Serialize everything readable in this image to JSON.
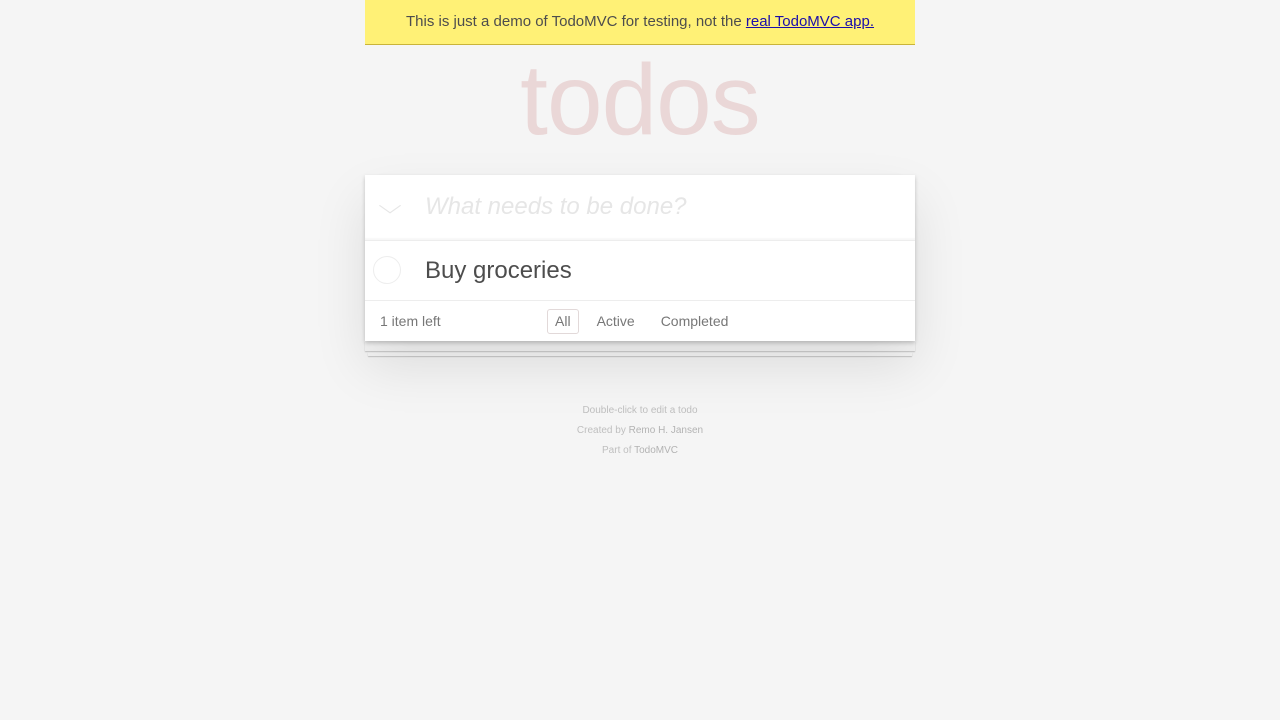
{
  "banner": {
    "text": "This is just a demo of TodoMVC for testing, not the ",
    "link": "real TodoMVC app."
  },
  "header": {
    "title": "todos"
  },
  "new_todo": {
    "placeholder": "What needs to be done?",
    "value": ""
  },
  "toggle_all_icon": "chevron-down-icon",
  "todos": [
    {
      "label": "Buy groceries",
      "completed": false
    }
  ],
  "footer": {
    "count_text": "1 item left",
    "filters": [
      {
        "label": "All",
        "selected": true
      },
      {
        "label": "Active",
        "selected": false
      },
      {
        "label": "Completed",
        "selected": false
      }
    ]
  },
  "info": {
    "line1": "Double-click to edit a todo",
    "created_prefix": "Created by ",
    "author": "Remo H. Jansen",
    "part_prefix": "Part of ",
    "part_link": "TodoMVC"
  }
}
